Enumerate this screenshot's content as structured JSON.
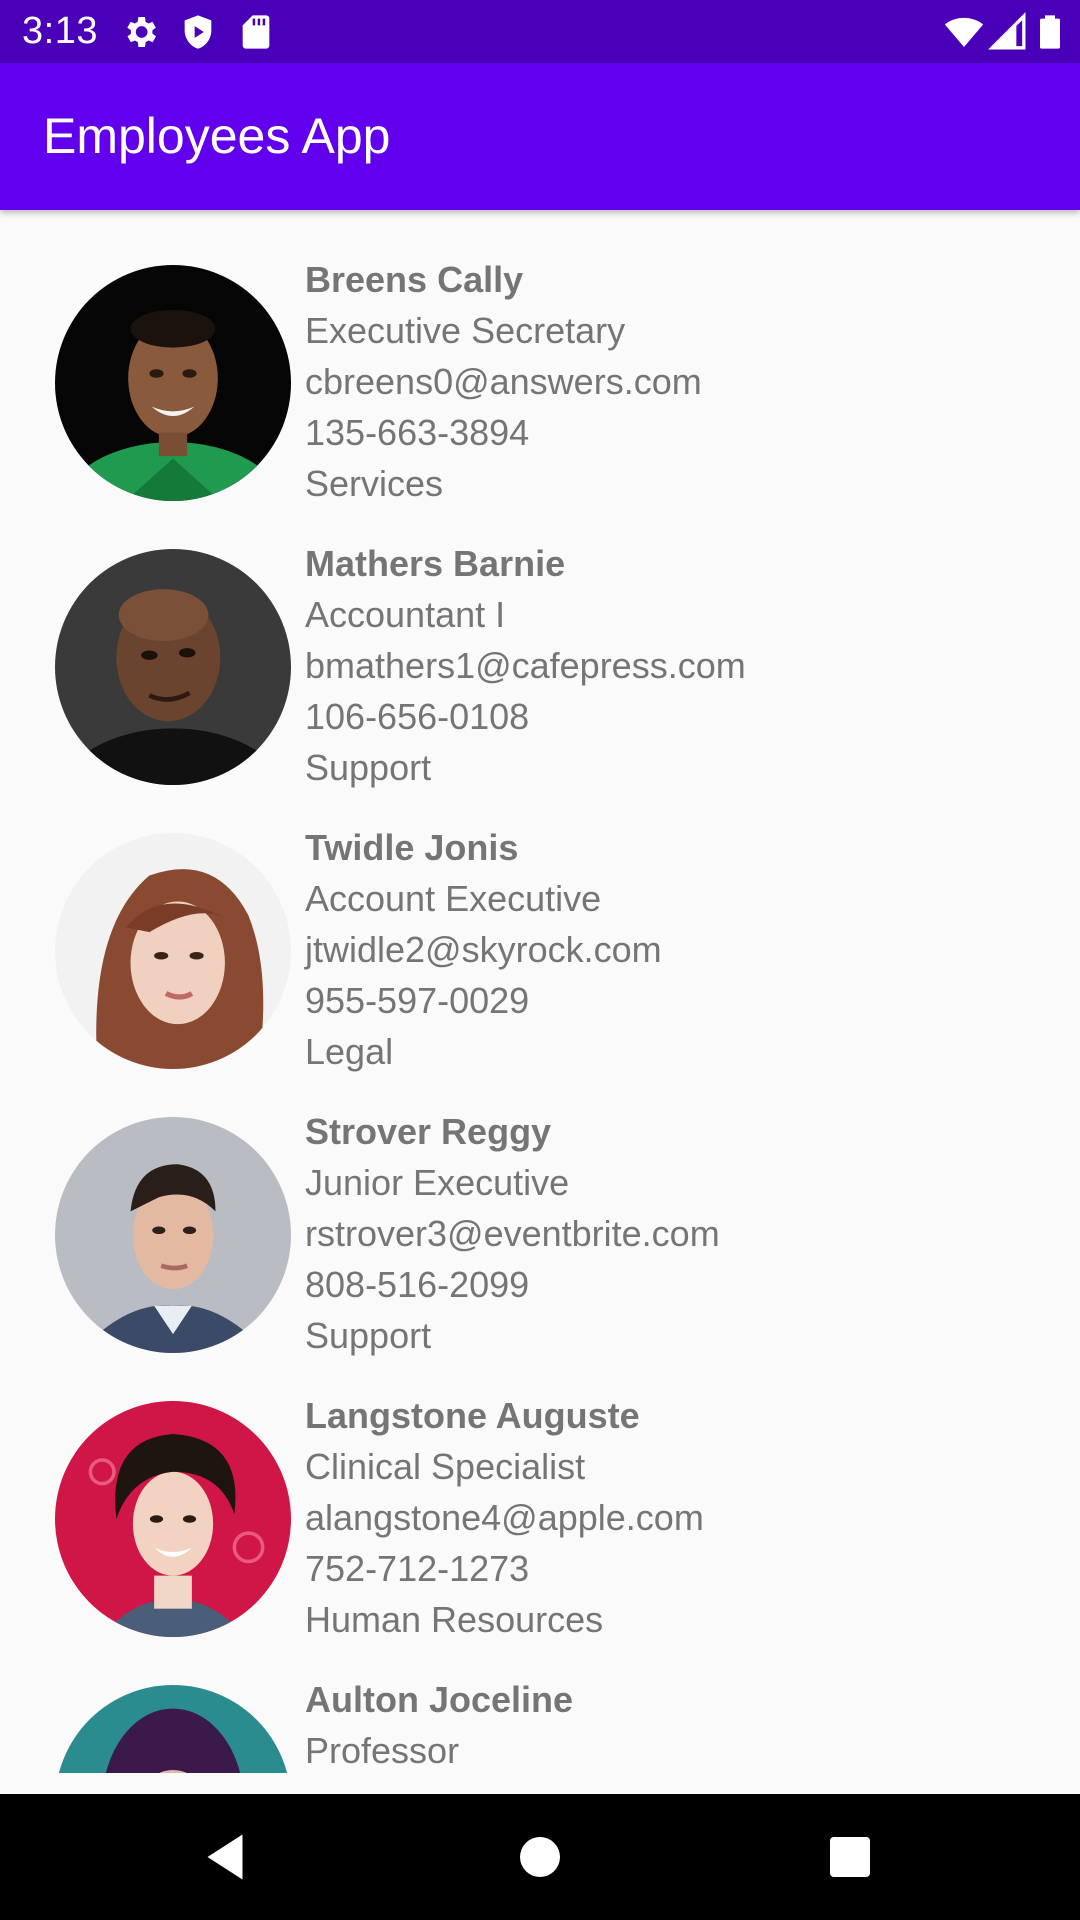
{
  "status_bar": {
    "time": "3:13",
    "left_icons": [
      "settings-gear-icon",
      "play-protect-icon",
      "sd-card-icon"
    ],
    "right_icons": [
      "wifi-icon",
      "cell-signal-icon",
      "battery-icon"
    ],
    "color": "#4a00b8"
  },
  "app_bar": {
    "title": "Employees App",
    "color": "#6200ee"
  },
  "employees": [
    {
      "name": "Breens Cally",
      "title": "Executive Secretary",
      "email": "cbreens0@answers.com",
      "phone": "135-663-3894",
      "department": "Services"
    },
    {
      "name": "Mathers Barnie",
      "title": "Accountant I",
      "email": "bmathers1@cafepress.com",
      "phone": "106-656-0108",
      "department": "Support"
    },
    {
      "name": "Twidle Jonis",
      "title": "Account Executive",
      "email": "jtwidle2@skyrock.com",
      "phone": "955-597-0029",
      "department": "Legal"
    },
    {
      "name": "Strover Reggy",
      "title": "Junior Executive",
      "email": "rstrover3@eventbrite.com",
      "phone": "808-516-2099",
      "department": "Support"
    },
    {
      "name": "Langstone Auguste",
      "title": "Clinical Specialist",
      "email": "alangstone4@apple.com",
      "phone": "752-712-1273",
      "department": "Human Resources"
    },
    {
      "name": "Aulton Joceline",
      "title": "Professor"
    }
  ],
  "nav_bar": {
    "buttons": [
      "back-icon",
      "home-icon",
      "recents-icon"
    ]
  }
}
